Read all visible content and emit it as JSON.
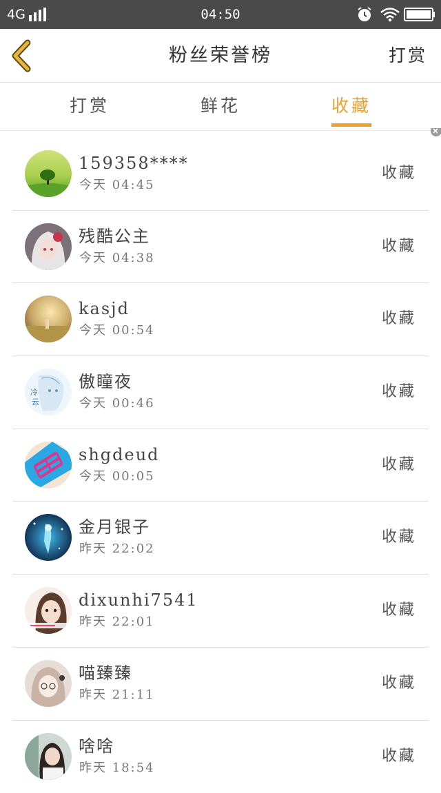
{
  "status_bar": {
    "network": "4G",
    "time": "04:50",
    "icons": [
      "signal-icon",
      "alarm-icon",
      "wifi-icon",
      "battery-icon"
    ]
  },
  "header": {
    "back_icon": "chevron-left-icon",
    "title": "粉丝荣誉榜",
    "action": "打赏"
  },
  "tabs": [
    {
      "label": "打赏",
      "active": false
    },
    {
      "label": "鲜花",
      "active": false
    },
    {
      "label": "收藏",
      "active": true
    }
  ],
  "colors": {
    "accent": "#f0a02a",
    "status_bar_bg": "#4a4a4a",
    "text_primary": "#444444",
    "text_secondary": "#777777",
    "divider": "#dedede"
  },
  "list": [
    {
      "name": "159358****",
      "date": "今天",
      "time": "04:45",
      "action": "收藏",
      "avatar": "avatar-green-tree"
    },
    {
      "name": "残酷公主",
      "date": "今天",
      "time": "04:38",
      "action": "收藏",
      "avatar": "avatar-anime-girl-white"
    },
    {
      "name": "kasjd",
      "date": "今天",
      "time": "00:54",
      "action": "收藏",
      "avatar": "avatar-field-sunset"
    },
    {
      "name": "傲瞳夜",
      "date": "今天",
      "time": "00:46",
      "action": "收藏",
      "avatar": "avatar-anime-blue-sketch"
    },
    {
      "name": "shgdeud",
      "date": "今天",
      "time": "00:05",
      "action": "收藏",
      "avatar": "avatar-pink-laces"
    },
    {
      "name": "金月银子",
      "date": "昨天",
      "time": "22:02",
      "action": "收藏",
      "avatar": "avatar-anime-night"
    },
    {
      "name": "dixunhi7541",
      "date": "昨天",
      "time": "22:01",
      "action": "收藏",
      "avatar": "avatar-girl-portrait"
    },
    {
      "name": "喵臻臻",
      "date": "昨天",
      "time": "21:11",
      "action": "收藏",
      "avatar": "avatar-illustrated-girl"
    },
    {
      "name": "啥啥",
      "date": "昨天",
      "time": "18:54",
      "action": "收藏",
      "avatar": "avatar-girl-photo"
    }
  ]
}
